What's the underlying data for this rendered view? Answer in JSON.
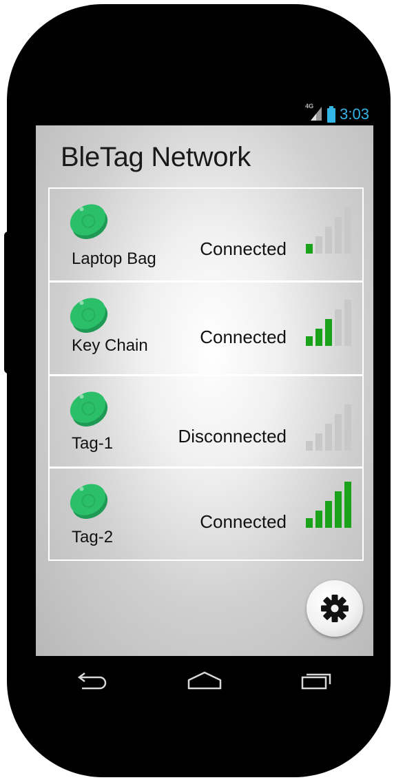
{
  "status_bar": {
    "network_label": "4G",
    "time": "3:03"
  },
  "app": {
    "title": "BleTag Network"
  },
  "colors": {
    "tag_green": "#2bbf6a",
    "signal_active": "#1aa31a",
    "signal_inactive": "#c8c8c8",
    "status_time": "#33b5e5"
  },
  "tags": [
    {
      "name": "Laptop Bag",
      "status": "Connected",
      "signal_bars": 1
    },
    {
      "name": "Key Chain",
      "status": "Connected",
      "signal_bars": 3
    },
    {
      "name": "Tag-1",
      "status": "Disconnected",
      "signal_bars": 0
    },
    {
      "name": "Tag-2",
      "status": "Connected",
      "signal_bars": 5
    }
  ],
  "settings": {
    "icon": "gear-icon"
  },
  "nav": {
    "back_icon": "back-icon",
    "home_icon": "home-icon",
    "recents_icon": "recent-apps-icon"
  }
}
